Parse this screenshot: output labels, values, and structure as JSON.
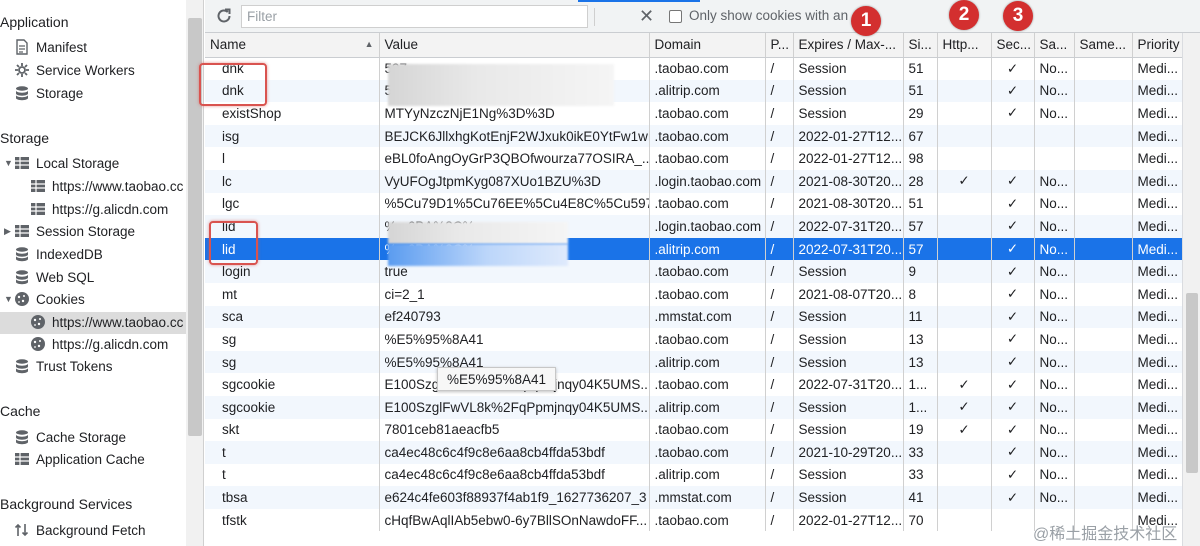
{
  "sidebar": {
    "sections": [
      {
        "title": "Application",
        "items": [
          "Manifest",
          "Service Workers",
          "Storage"
        ]
      },
      {
        "title": "Storage",
        "items": [
          "Local Storage",
          "https://www.taobao.cc",
          "https://g.alicdn.com",
          "Session Storage",
          "IndexedDB",
          "Web SQL",
          "Cookies",
          "https://www.taobao.cc",
          "https://g.alicdn.com",
          "Trust Tokens"
        ]
      },
      {
        "title": "Cache",
        "items": [
          "Cache Storage",
          "Application Cache"
        ]
      },
      {
        "title": "Background Services",
        "items": [
          "Background Fetch"
        ]
      }
    ]
  },
  "toolbar": {
    "filter_placeholder": "Filter",
    "only_show_label": "Only show cookies with an"
  },
  "table": {
    "columns": [
      "Name",
      "Value",
      "Domain",
      "P...",
      "Expires / Max-...",
      "Si...",
      "Http...",
      "Sec...",
      "Sa...",
      "Same...",
      "Priority"
    ],
    "rows": [
      [
        "dnk",
        "597...",
        ".taobao.com",
        "/",
        "Session",
        "51",
        "",
        "✓",
        "No...",
        "",
        "Medi..."
      ],
      [
        "dnk",
        "597...",
        ".alitrip.com",
        "/",
        "Session",
        "51",
        "",
        "✓",
        "No...",
        "",
        "Medi..."
      ],
      [
        "existShop",
        "MTYyNzczNjE1Ng%3D%3D",
        ".taobao.com",
        "/",
        "Session",
        "29",
        "",
        "✓",
        "No...",
        "",
        "Medi..."
      ],
      [
        "isg",
        "BEJCK6JllxhgKotEnjF2WJxuk0ikE0YtFw1wL...",
        ".taobao.com",
        "/",
        "2022-01-27T12...",
        "67",
        "",
        "",
        "",
        "",
        "Medi..."
      ],
      [
        "l",
        "eBL0foAngOyGrP3QBOfwourza77OSIRA_...",
        ".taobao.com",
        "/",
        "2022-01-27T12...",
        "98",
        "",
        "",
        "",
        "",
        "Medi..."
      ],
      [
        "lc",
        "VyUFOgJtpmKyg087XUo1BZU%3D",
        ".login.taobao.com",
        "/",
        "2021-08-30T20...",
        "28",
        "✓",
        "✓",
        "No...",
        "",
        "Medi..."
      ],
      [
        "lgc",
        "%5Cu79D1%5Cu76EE%5Cu4E8C%5Cu597...",
        ".taobao.com",
        "/",
        "2021-08-30T20...",
        "51",
        "",
        "✓",
        "No...",
        "",
        "Medi..."
      ],
      [
        "lid",
        "%...6BA%8C%...",
        ".login.taobao.com",
        "/",
        "2022-07-31T20...",
        "57",
        "",
        "✓",
        "No...",
        "",
        "Medi..."
      ],
      [
        "lid",
        "%...6BA%8C%...",
        ".alitrip.com",
        "/",
        "2022-07-31T20...",
        "57",
        "",
        "✓",
        "No...",
        "",
        "Medi..."
      ],
      [
        "login",
        "true",
        ".taobao.com",
        "/",
        "Session",
        "9",
        "",
        "✓",
        "No...",
        "",
        "Medi..."
      ],
      [
        "mt",
        "ci=2_1",
        ".taobao.com",
        "/",
        "2021-08-07T20...",
        "8",
        "",
        "✓",
        "No...",
        "",
        "Medi..."
      ],
      [
        "sca",
        "ef240793",
        ".mmstat.com",
        "/",
        "Session",
        "11",
        "",
        "✓",
        "No...",
        "",
        "Medi..."
      ],
      [
        "sg",
        "%E5%95%8A41",
        ".taobao.com",
        "/",
        "Session",
        "13",
        "",
        "✓",
        "No...",
        "",
        "Medi..."
      ],
      [
        "sg",
        "%E5%95%8A41",
        ".alitrip.com",
        "/",
        "Session",
        "13",
        "",
        "✓",
        "No...",
        "",
        "Medi..."
      ],
      [
        "sgcookie",
        "E100SzglFwVL8k%2FqPpmjnqy04K5UMS...",
        ".taobao.com",
        "/",
        "2022-07-31T20...",
        "1...",
        "✓",
        "✓",
        "No...",
        "",
        "Medi..."
      ],
      [
        "sgcookie",
        "E100SzglFwVL8k%2FqPpmjnqy04K5UMS...",
        ".alitrip.com",
        "/",
        "Session",
        "1...",
        "✓",
        "✓",
        "No...",
        "",
        "Medi..."
      ],
      [
        "skt",
        "7801ceb81aeacfb5",
        ".taobao.com",
        "/",
        "Session",
        "19",
        "✓",
        "✓",
        "No...",
        "",
        "Medi..."
      ],
      [
        "t",
        "ca4ec48c6c4f9c8e6aa8cb4ffda53bdf",
        ".taobao.com",
        "/",
        "2021-10-29T20...",
        "33",
        "",
        "✓",
        "No...",
        "",
        "Medi..."
      ],
      [
        "t",
        "ca4ec48c6c4f9c8e6aa8cb4ffda53bdf",
        ".alitrip.com",
        "/",
        "Session",
        "33",
        "",
        "✓",
        "No...",
        "",
        "Medi..."
      ],
      [
        "tbsa",
        "e624c4fe603f88937f4ab1f9_1627736207_3",
        ".mmstat.com",
        "/",
        "Session",
        "41",
        "",
        "✓",
        "No...",
        "",
        "Medi..."
      ],
      [
        "tfstk",
        "cHqfBwAqlIAb5ebw0-6y7BllSOnNawdoFF...",
        ".taobao.com",
        "/",
        "2022-01-27T12...",
        "70",
        "",
        "",
        "",
        "",
        "Medi..."
      ]
    ],
    "selected_row_index": 8
  },
  "tooltip": "%E5%95%8A41",
  "annotations": [
    "1",
    "2",
    "3"
  ],
  "watermark": "@稀土掘金技术社区",
  "colors": {
    "selection": "#1a73e8",
    "annotation": "#d32f2f",
    "stripe": "#f2f7fd"
  }
}
